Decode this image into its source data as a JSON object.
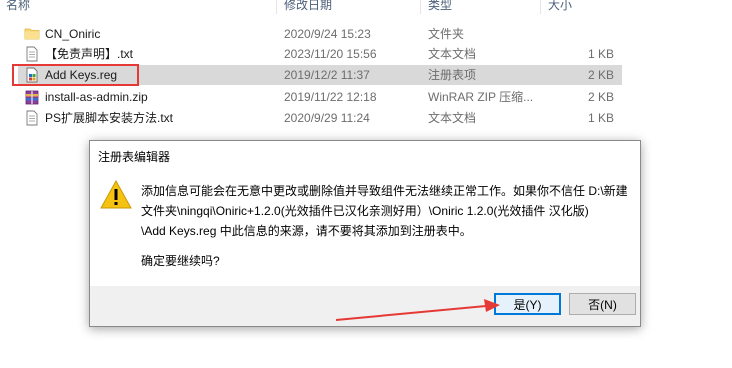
{
  "explorer": {
    "columns": {
      "name": "名称",
      "date": "修改日期",
      "type": "类型",
      "size": "大小"
    },
    "files": [
      {
        "name": "CN_Oniric",
        "date": "2020/9/24 15:23",
        "type": "文件夹",
        "size": "",
        "icon": "folder-icon"
      },
      {
        "name": "【免责声明】.txt",
        "date": "2023/11/20 15:56",
        "type": "文本文档",
        "size": "1 KB",
        "icon": "text-file-icon"
      },
      {
        "name": "Add Keys.reg",
        "date": "2019/12/2 11:37",
        "type": "注册表项",
        "size": "2 KB",
        "icon": "registry-file-icon"
      },
      {
        "name": "install-as-admin.zip",
        "date": "2019/11/22 12:18",
        "type": "WinRAR ZIP 压缩...",
        "size": "2 KB",
        "icon": "zip-archive-icon"
      },
      {
        "name": "PS扩展脚本安装方法.txt",
        "date": "2020/9/29 11:24",
        "type": "文本文档",
        "size": "1 KB",
        "icon": "text-file-icon"
      }
    ]
  },
  "dialog": {
    "title": "注册表编辑器",
    "message_lines": [
      "添加信息可能会在无意中更改或删除值并导致组件无法继续正常工作。如果你不信任 D:\\新建",
      "文件夹\\ningqi\\Oniric+1.2.0(光效插件已汉化亲测好用）\\Oniric 1.2.0(光效插件 汉化版)",
      "\\Add Keys.reg 中此信息的来源，请不要将其添加到注册表中。"
    ],
    "question": "确定要继续吗?",
    "yes_label": "是(Y)",
    "no_label": "否(N)"
  },
  "colors": {
    "annotation": "#e53935",
    "selection": "#d9d9d9",
    "default_button_border": "#0078d7",
    "warning": "#f5c211"
  }
}
